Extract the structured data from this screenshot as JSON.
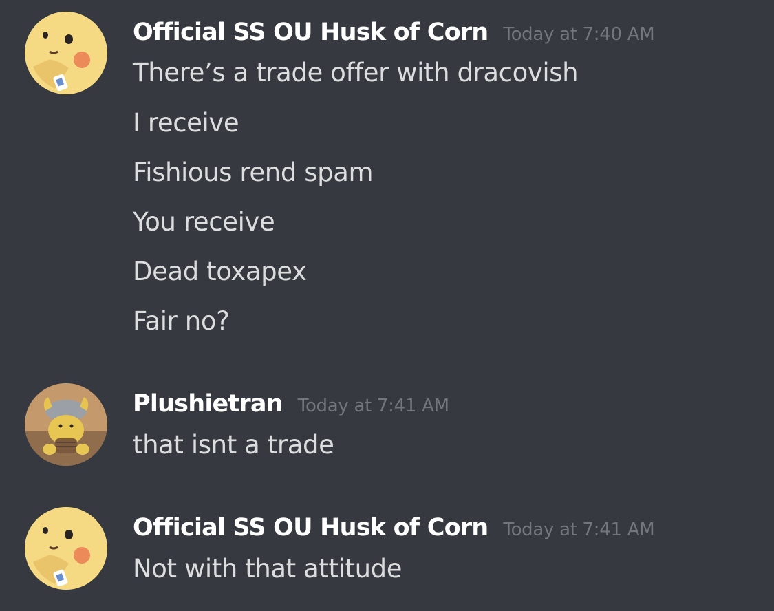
{
  "messages": [
    {
      "username": "Official SS OU Husk of Corn",
      "timestamp": "Today at 7:40 AM",
      "avatar": "pikachu-avatar",
      "lines": [
        "There’s a trade offer with dracovish",
        "I receive",
        "Fishious rend spam",
        "You receive",
        "Dead toxapex",
        "Fair no?"
      ]
    },
    {
      "username": "Plushietran",
      "timestamp": "Today at 7:41 AM",
      "avatar": "plush-avatar",
      "lines": [
        "that isnt a trade"
      ]
    },
    {
      "username": "Official SS OU Husk of Corn",
      "timestamp": "Today at 7:41 AM",
      "avatar": "pikachu-avatar",
      "lines": [
        "Not with that attitude"
      ]
    }
  ],
  "colors": {
    "background": "#36393f",
    "username": "#ffffff",
    "timestamp": "#72767d",
    "text": "#dcddde"
  }
}
